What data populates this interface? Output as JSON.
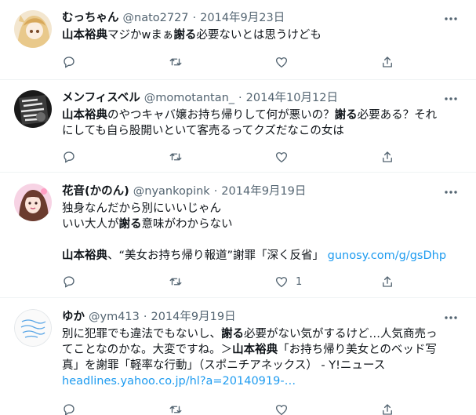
{
  "colors": {
    "text": "#0f1419",
    "secondary": "#536471",
    "link": "#1d9bf0",
    "divider": "#eff3f4"
  },
  "tweets": [
    {
      "name": "むっちゃん",
      "handle": "@nato2727",
      "sep": "·",
      "date": "2014年9月23日",
      "lines": [
        [
          {
            "t": "山本裕典",
            "b": true
          },
          {
            "t": "マジかwまぁ"
          },
          {
            "t": "謝る",
            "b": true
          },
          {
            "t": "必要ないとは思うけども"
          }
        ]
      ],
      "actions": {
        "reply": "",
        "retweet": "",
        "like": "",
        "share": ""
      }
    },
    {
      "name": "メンフィスベル",
      "handle": "@momotantan_",
      "sep": "·",
      "date": "2014年10月12日",
      "lines": [
        [
          {
            "t": "山本裕典",
            "b": true
          },
          {
            "t": "のやつキャバ嬢お持ち帰りして何が悪いの？"
          },
          {
            "t": "謝る",
            "b": true
          },
          {
            "t": "必要ある？それ"
          }
        ],
        [
          {
            "t": "にしても自ら股開いといて客売るってクズだなこの女は"
          }
        ]
      ],
      "actions": {
        "reply": "",
        "retweet": "",
        "like": "",
        "share": ""
      }
    },
    {
      "name": "花音(かのん)",
      "handle": "@nyankopink",
      "sep": "·",
      "date": "2014年9月19日",
      "lines": [
        [
          {
            "t": "独身なんだから別にいいじゃん"
          }
        ],
        [
          {
            "t": "いい大人が"
          },
          {
            "t": "謝る",
            "b": true
          },
          {
            "t": "意味がわからない"
          }
        ],
        [],
        [
          {
            "t": "山本裕典",
            "b": true
          },
          {
            "t": "、“美女お持ち帰り報道”謝罪「深く反省」 "
          },
          {
            "t": "gunosy.com/g/gsDhp",
            "link": true
          }
        ]
      ],
      "actions": {
        "reply": "",
        "retweet": "",
        "like": "1",
        "share": ""
      }
    },
    {
      "name": "ゆか",
      "handle": "@ym413",
      "sep": "·",
      "date": "2014年9月19日",
      "lines": [
        [
          {
            "t": "別に犯罪でも違法でもないし、"
          },
          {
            "t": "謝る",
            "b": true
          },
          {
            "t": "必要がない気がするけど…人気商売っ"
          }
        ],
        [
          {
            "t": "てことなのかな。大変ですね。＞"
          },
          {
            "t": "山本裕典",
            "b": true
          },
          {
            "t": "「お持ち帰り美女とのベッド写"
          }
        ],
        [
          {
            "t": "真」を謝罪「軽率な行動」（スポニチアネックス） - Y!ニュース"
          }
        ],
        [
          {
            "t": "headlines.yahoo.co.jp/hl?a=20140919-…",
            "link": true
          }
        ]
      ],
      "actions": {
        "reply": "",
        "retweet": "",
        "like": "",
        "share": ""
      }
    }
  ]
}
